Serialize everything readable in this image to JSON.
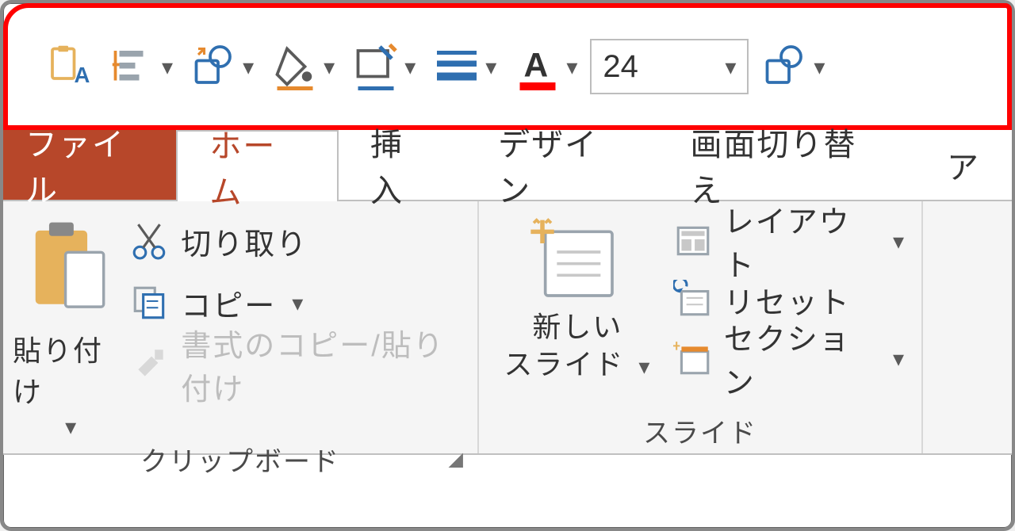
{
  "qat": {
    "font_size_value": "24"
  },
  "tabs": {
    "file": "ファイル",
    "home": "ホーム",
    "insert": "挿入",
    "design": "デザイン",
    "transitions": "画面切り替え",
    "animations_partial": "ア"
  },
  "ribbon": {
    "clipboard": {
      "paste": "貼り付け",
      "cut": "切り取り",
      "copy": "コピー",
      "format_painter": "書式のコピー/貼り付け",
      "group_label": "クリップボード"
    },
    "slides": {
      "new_slide_line1": "新しい",
      "new_slide_line2": "スライド",
      "layout": "レイアウト",
      "reset": "リセット",
      "section": "セクション",
      "group_label": "スライド"
    }
  }
}
